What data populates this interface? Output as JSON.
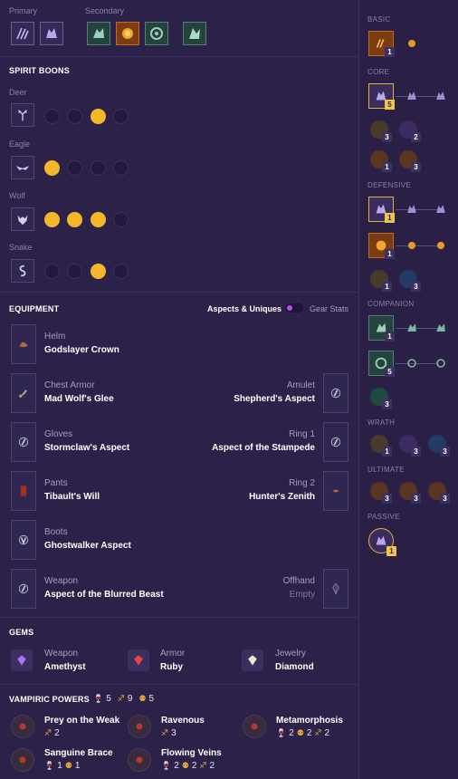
{
  "skillbar": {
    "primary_label": "Primary",
    "secondary_label": "Secondary"
  },
  "spirit_boons": {
    "title": "SPIRIT BOONS",
    "groups": [
      {
        "name": "Deer",
        "icon": "deer-icon",
        "selected": [
          3
        ]
      },
      {
        "name": "Eagle",
        "icon": "eagle-icon",
        "selected": [
          1
        ]
      },
      {
        "name": "Wolf",
        "icon": "wolf-icon",
        "selected": [
          1,
          2,
          3
        ]
      },
      {
        "name": "Snake",
        "icon": "snake-icon",
        "selected": [
          3
        ]
      }
    ]
  },
  "equipment": {
    "title": "EQUIPMENT",
    "toggle_left": "Aspects & Uniques",
    "toggle_right": "Gear Stats",
    "left": [
      {
        "slot": "Helm",
        "name": "Godslayer Crown"
      },
      {
        "slot": "Chest Armor",
        "name": "Mad Wolf's Glee"
      },
      {
        "slot": "Gloves",
        "name": "Stormclaw's Aspect"
      },
      {
        "slot": "Pants",
        "name": "Tibault's Will"
      },
      {
        "slot": "Boots",
        "name": "Ghostwalker Aspect"
      },
      {
        "slot": "Weapon",
        "name": "Aspect of the Blurred Beast"
      }
    ],
    "right": [
      {
        "slot": "Amulet",
        "name": "Shepherd's Aspect"
      },
      {
        "slot": "Ring 1",
        "name": "Aspect of the Stampede"
      },
      {
        "slot": "Ring 2",
        "name": "Hunter's Zenith"
      },
      {
        "slot": "Offhand",
        "name": "Empty"
      }
    ]
  },
  "gems": {
    "title": "GEMS",
    "items": [
      {
        "slot": "Weapon",
        "name": "Amethyst",
        "color": "#b06ff0"
      },
      {
        "slot": "Armor",
        "name": "Ruby",
        "color": "#e8434a"
      },
      {
        "slot": "Jewelry",
        "name": "Diamond",
        "color": "#f1e7cc"
      }
    ]
  },
  "vampiric": {
    "title": "VAMPIRIC POWERS",
    "totals": [
      "5",
      "9",
      "5"
    ],
    "powers": [
      {
        "name": "Prey on the Weak",
        "stats": [
          "2"
        ]
      },
      {
        "name": "Ravenous",
        "stats": [
          "3"
        ]
      },
      {
        "name": "Metamorphosis",
        "stats": [
          "2",
          "2",
          "2"
        ]
      },
      {
        "name": "Sanguine Brace",
        "stats": [
          "1",
          "1"
        ]
      },
      {
        "name": "Flowing Veins",
        "stats": [
          "2",
          "2",
          "2"
        ]
      }
    ]
  },
  "skilltree": {
    "basic": "BASIC",
    "core": "CORE",
    "defensive": "DEFENSIVE",
    "companion": "COMPANION",
    "wrath": "WRATH",
    "ultimate": "ULTIMATE",
    "passive": "PASSIVE",
    "counts": {
      "basic_main": "1",
      "core_main": "5",
      "core_a": "3",
      "core_b": "2",
      "core_c": "1",
      "core_d": "3",
      "def_main": "1",
      "def_second": "1",
      "def_a": "1",
      "def_b": "3",
      "comp_main": "1",
      "comp_second": "5",
      "comp_a": "3",
      "wrath_a": "1",
      "wrath_b": "3",
      "wrath_c": "3",
      "ult_a": "3",
      "ult_b": "3",
      "ult_c": "3",
      "passive_main": "1"
    }
  }
}
